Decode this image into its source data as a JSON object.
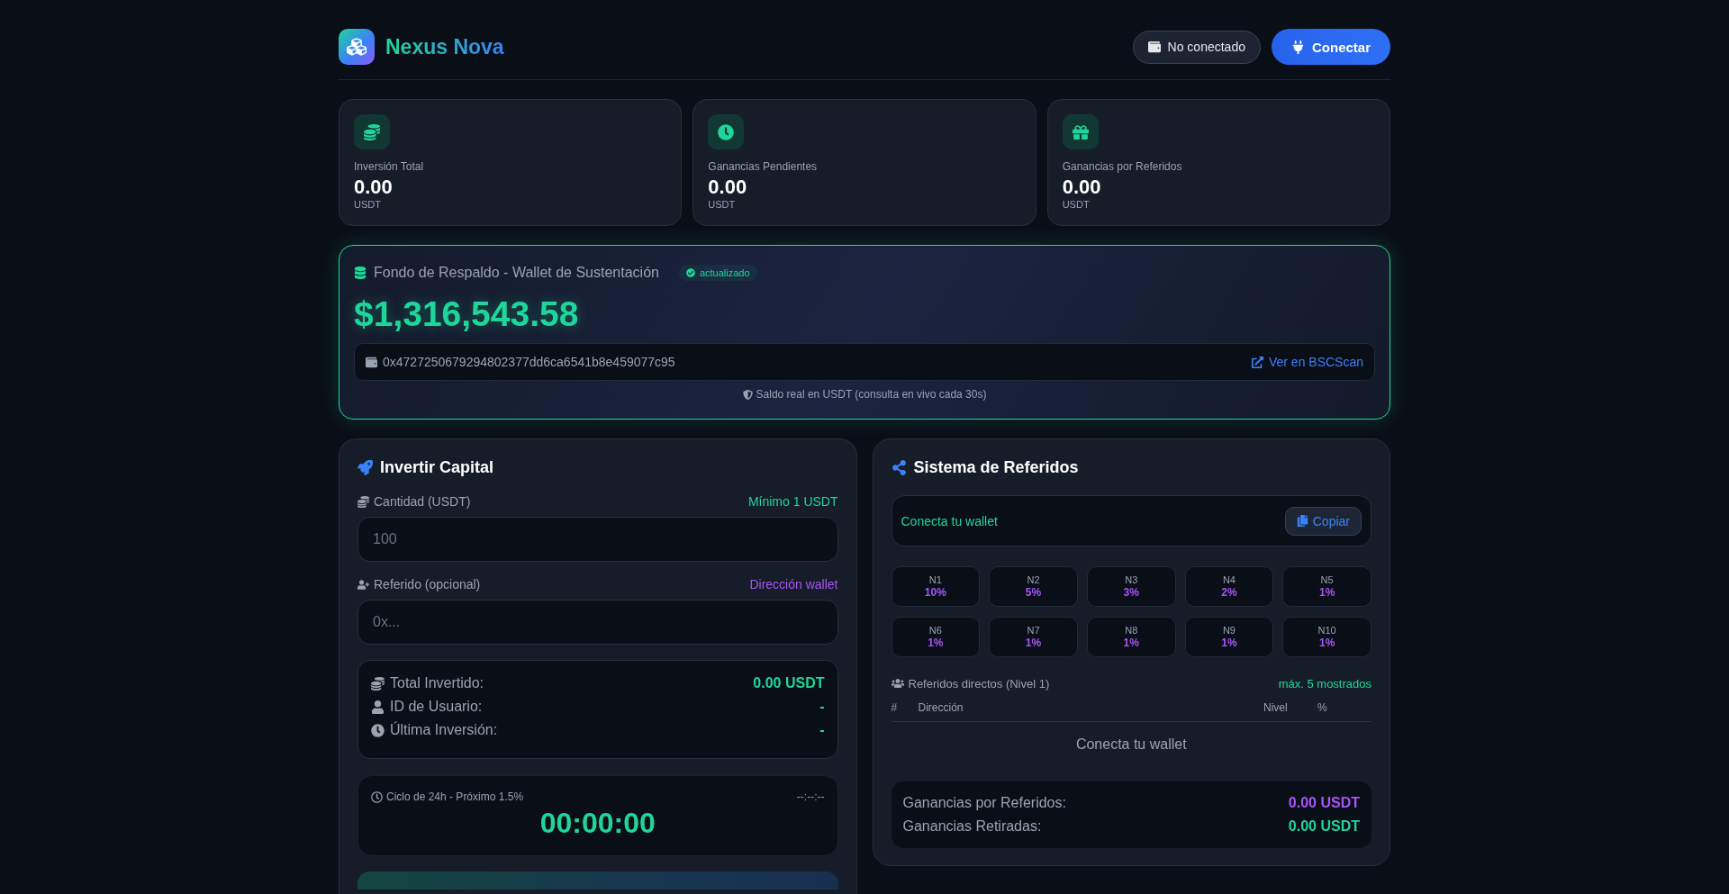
{
  "header": {
    "brand": "Nexus Nova",
    "status": "No conectado",
    "connect_button": "Conectar"
  },
  "stats": [
    {
      "label": "Inversión Total",
      "value": "0.00",
      "unit": "USDT"
    },
    {
      "label": "Ganancias Pendientes",
      "value": "0.00",
      "unit": "USDT"
    },
    {
      "label": "Ganancias por Referidos",
      "value": "0.00",
      "unit": "USDT"
    }
  ],
  "fund": {
    "title": "Fondo de Respaldo - Wallet de Sustentación",
    "badge": "actualizado",
    "amount": "$1,316,543.58",
    "address": "0x4727250679294802377dd6ca6541b8e459077c95",
    "link": "Ver en BSCScan",
    "note": "Saldo real en USDT (consulta en vivo cada 30s)"
  },
  "invest": {
    "title": "Invertir Capital",
    "fields": [
      {
        "label": "Cantidad (USDT)",
        "hint": "Mínimo 1 USDT",
        "color": "#1fd69a",
        "placeholder": "100"
      },
      {
        "label": "Referido (opcional)",
        "hint": "Dirección wallet",
        "color": "#a855f7",
        "placeholder": "0x..."
      }
    ],
    "summary": [
      {
        "label": "Total Invertido:",
        "value": "0.00 USDT"
      },
      {
        "label": "ID de Usuario:",
        "value": "-"
      },
      {
        "label": "Última Inversión:",
        "value": "-"
      }
    ],
    "cycle": {
      "label": "Ciclo de 24h - Próximo 1.5%",
      "clock": "--:--:--",
      "countdown": "00:00:00"
    }
  },
  "referrals": {
    "title": "Sistema de Referidos",
    "link": {
      "text": "Conecta tu wallet",
      "button": "Copiar"
    },
    "levels": [
      {
        "level": "N1",
        "percent": "10%"
      },
      {
        "level": "N2",
        "percent": "5%"
      },
      {
        "level": "N3",
        "percent": "3%"
      },
      {
        "level": "N4",
        "percent": "2%"
      },
      {
        "level": "N5",
        "percent": "1%"
      },
      {
        "level": "N6",
        "percent": "1%"
      },
      {
        "level": "N7",
        "percent": "1%"
      },
      {
        "level": "N8",
        "percent": "1%"
      },
      {
        "level": "N9",
        "percent": "1%"
      },
      {
        "level": "N10",
        "percent": "1%"
      }
    ],
    "direct": {
      "title": "Referidos directos (Nivel 1)",
      "note": "máx. 5 mostrados"
    },
    "table": {
      "columns": [
        "#",
        "Dirección",
        "Nivel",
        "%"
      ],
      "empty": "Conecta tu wallet"
    },
    "earnings": [
      {
        "label": "Ganancias por Referidos:",
        "value": "0.00 USDT",
        "color": "#a855f7"
      },
      {
        "label": "Ganancias Retiradas:",
        "value": "0.00 USDT",
        "color": "#1fd69a"
      }
    ]
  }
}
